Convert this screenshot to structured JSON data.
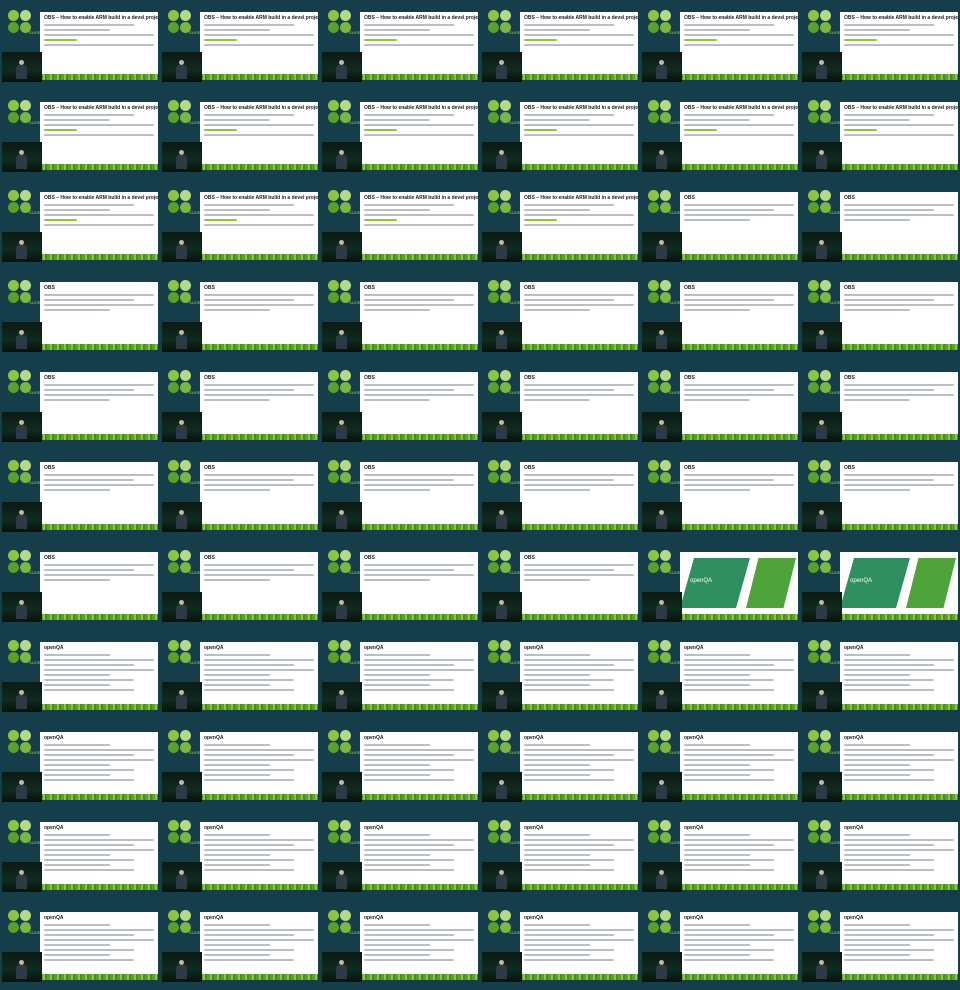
{
  "grid": {
    "rows": 11,
    "cols": 6
  },
  "logo_text": "SUSE",
  "slide_titles": {
    "obs_howto": "OBS – How to enable ARM build in a devel project",
    "obs": "OBS",
    "openqa_cover": "openQA",
    "openqa": "openQA"
  },
  "sequence": [
    "obs_howto",
    "obs_howto",
    "obs_howto",
    "obs_howto",
    "obs_howto",
    "obs_howto",
    "obs_howto",
    "obs_howto",
    "obs_howto",
    "obs_howto",
    "obs_howto",
    "obs_howto",
    "obs_howto",
    "obs_howto",
    "obs_howto",
    "obs_howto",
    "obs",
    "obs",
    "obs",
    "obs",
    "obs",
    "obs",
    "obs",
    "obs",
    "obs",
    "obs",
    "obs",
    "obs",
    "obs",
    "obs",
    "obs",
    "obs",
    "obs",
    "obs",
    "obs",
    "obs",
    "obs",
    "obs",
    "obs",
    "obs",
    "openqa_cover",
    "openqa_cover",
    "openqa",
    "openqa",
    "openqa",
    "openqa",
    "openqa",
    "openqa",
    "openqa",
    "openqa",
    "openqa",
    "openqa",
    "openqa",
    "openqa",
    "openqa",
    "openqa",
    "openqa",
    "openqa",
    "openqa",
    "openqa",
    "openqa",
    "openqa",
    "openqa",
    "openqa",
    "openqa",
    "openqa"
  ]
}
